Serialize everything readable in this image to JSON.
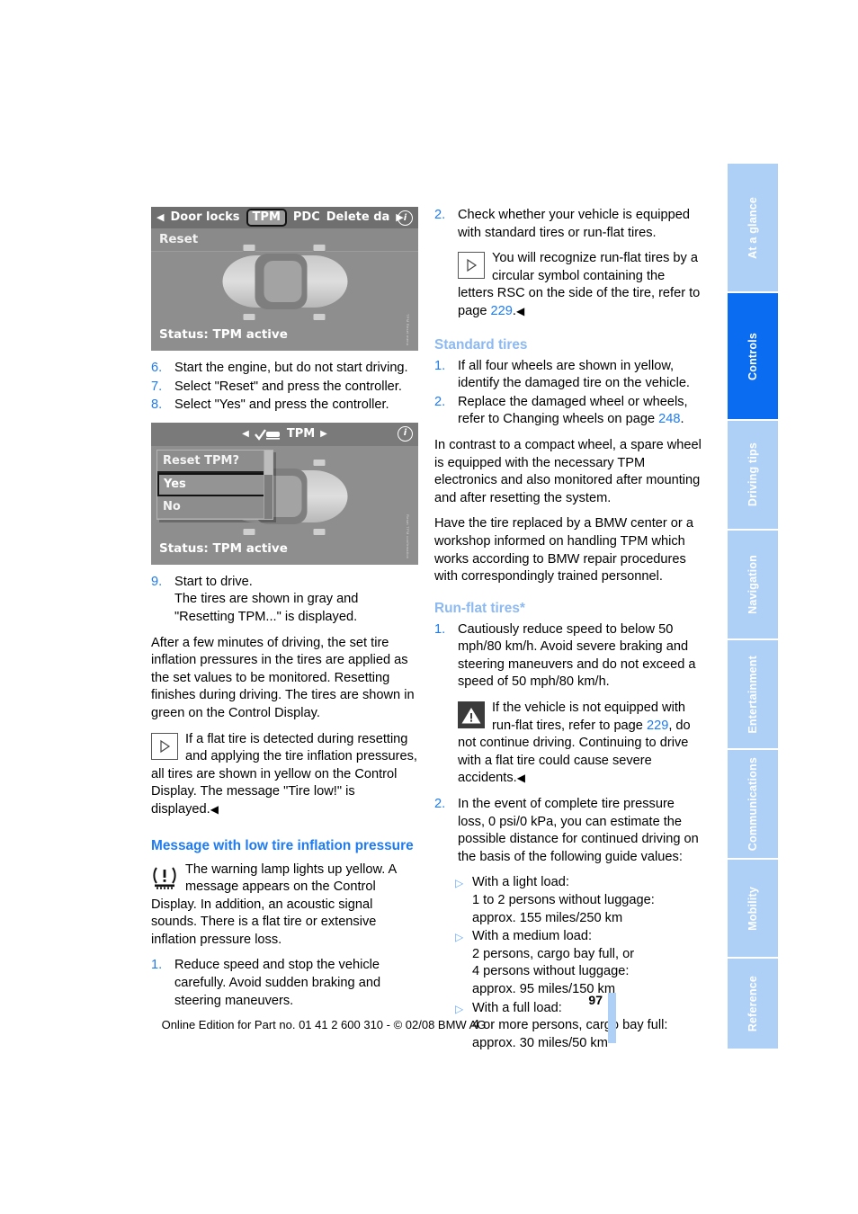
{
  "document": {
    "page_number": "97",
    "footer_note": "Online Edition for Part no. 01 41 2 600 310 - © 02/08 BMW AG"
  },
  "tab_rail": {
    "tabs": [
      {
        "label": "At a glance",
        "active": false
      },
      {
        "label": "Controls",
        "active": true
      },
      {
        "label": "Driving tips",
        "active": false
      },
      {
        "label": "Navigation",
        "active": false
      },
      {
        "label": "Entertainment",
        "active": false
      },
      {
        "label": "Communications",
        "active": false
      },
      {
        "label": "Mobility",
        "active": false
      },
      {
        "label": "Reference",
        "active": false
      }
    ]
  },
  "colors": {
    "accent_blue": "#1f7bf0",
    "light_blue": "#8cb9f2",
    "tab_blue": "#aed0f7",
    "tab_active_blue": "#0a6cf0"
  },
  "figure_one": {
    "menu_back_arrow": "◀",
    "menu_items": [
      "Door locks",
      "TPM",
      "PDC",
      "Delete da"
    ],
    "selected_menu_item": "TPM",
    "menu_forward_arrow": "▶",
    "info_icon": "i",
    "row_label": "Reset",
    "status": "Status: TPM active",
    "caption": "TPM Reset menu"
  },
  "figure_two": {
    "header_left_arrow": "◀",
    "header_title": "TPM",
    "header_right_arrow": "▶",
    "info_icon": "i",
    "dialog_title": "Reset TPM?",
    "dialog_options": [
      "Yes",
      "No"
    ],
    "dialog_selected": "Yes",
    "status": "Status: TPM active",
    "caption": "Reset TPM confirmation"
  },
  "left_column": {
    "steps_6_8": [
      {
        "num": "6.",
        "text": "Start the engine, but do not start driving."
      },
      {
        "num": "7.",
        "text": "Select \"Reset\" and press the controller."
      },
      {
        "num": "8.",
        "text": "Select \"Yes\" and press the controller."
      }
    ],
    "step_9": {
      "num": "9.",
      "line1": "Start to drive.",
      "line2": "The tires are shown in gray and \"Resetting TPM...\" is displayed."
    },
    "paragraph_after_drive": "After a few minutes of driving, the set tire inflation pressures in the tires are applied as the set values to be monitored. Resetting finishes during driving. The tires are shown in green on the Control Display.",
    "note_flat_tire": {
      "icon": "note-triangle-icon",
      "text": "If a flat tire is detected during resetting and applying the tire inflation pressures, all tires are shown in yellow on the Control Display. The message \"Tire low!\" is displayed.",
      "endmark": "◀"
    },
    "heading_message": "Message with low tire inflation pressure",
    "warning_lamp": {
      "icon": "tire-pressure-warning-icon",
      "text": "The warning lamp lights up yellow. A message appears on the Control Display. In addition, an acoustic signal sounds. There is a flat tire or extensive inflation pressure loss."
    },
    "step_1": {
      "num": "1.",
      "text": "Reduce speed and stop the vehicle carefully. Avoid sudden braking and steering maneuvers."
    }
  },
  "right_column": {
    "step_2": {
      "num": "2.",
      "text": "Check whether your vehicle is equipped with standard tires or run-flat tires."
    },
    "note_rsc": {
      "icon": "note-triangle-icon",
      "text_before": "You will recognize run-flat tires by a circular symbol containing the letters RSC on the side of the tire, refer to page ",
      "page_ref": "229",
      "text_after": ".",
      "endmark": "◀"
    },
    "heading_standard_tires": "Standard tires",
    "standard_steps": [
      {
        "num": "1.",
        "text": "If all four wheels are shown in yellow, identify the damaged tire on the vehicle."
      },
      {
        "num": "2.",
        "text_before": "Replace the damaged wheel or wheels, refer to Changing wheels on page ",
        "page_ref": "248",
        "text_after": "."
      }
    ],
    "paragraph_spare_wheel": "In contrast to a compact wheel, a spare wheel is equipped with the necessary TPM electronics and also monitored after mounting and after resetting the system.",
    "paragraph_bmw_center": "Have the tire replaced by a BMW center or a workshop informed on handling TPM which works according to BMW repair procedures with correspondingly trained personnel.",
    "heading_runflat_tires": "Run-flat tires*",
    "runflat_step_1": {
      "num": "1.",
      "text": "Cautiously reduce speed to below 50 mph/80 km/h. Avoid severe braking and steering maneuvers and do not exceed a speed of 50 mph/80 km/h."
    },
    "warning_runflat": {
      "icon": "warning-triangle-icon",
      "text_before": "If the vehicle is not equipped with run-flat tires, refer to page ",
      "page_ref": "229",
      "text_after": ", do not continue driving. Continuing to drive with a flat tire could cause severe accidents.",
      "endmark": "◀"
    },
    "runflat_step_2": {
      "num": "2.",
      "text": "In the event of complete tire pressure loss, 0 psi/0 kPa, you can estimate the possible distance for continued driving on the basis of the following guide values:"
    },
    "load_bullets": [
      {
        "mark": "▷",
        "title": "With a light load:",
        "detail1": "1 to 2 persons without luggage:",
        "detail2": "approx. 155 miles/250 km"
      },
      {
        "mark": "▷",
        "title": "With a medium load:",
        "detail1": "2 persons, cargo bay full, or",
        "detail1b": "4 persons without luggage:",
        "detail2": "approx. 95 miles/150 km"
      },
      {
        "mark": "▷",
        "title": "With a full load:",
        "detail1": "4 or more persons, cargo bay full:",
        "detail2": "approx. 30 miles/50 km"
      }
    ]
  }
}
